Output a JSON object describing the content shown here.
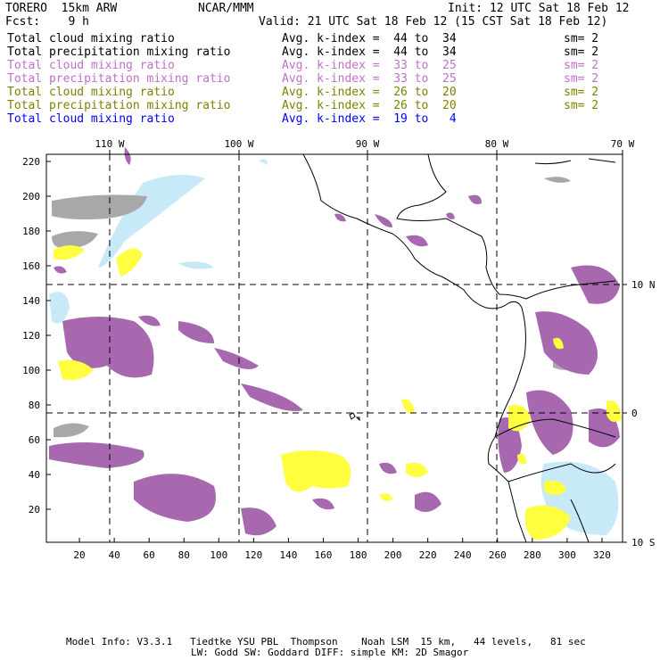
{
  "header": {
    "model": "TORERO  15km ARW",
    "org": "NCAR/MMM",
    "init": "Init: 12 UTC Sat 18 Feb 12",
    "fcst": "Fcst:    9 h",
    "valid": "Valid: 21 UTC Sat 18 Feb 12 (15 CST Sat 18 Feb 12)"
  },
  "legend": [
    {
      "field": "Total cloud mixing ratio",
      "kindex": "Avg. k-index =  44 to  34",
      "sm": "sm= 2",
      "color": "#000000"
    },
    {
      "field": "Total precipitation mixing ratio",
      "kindex": "Avg. k-index =  44 to  34",
      "sm": "sm= 2",
      "color": "#000000"
    },
    {
      "field": "Total cloud mixing ratio",
      "kindex": "Avg. k-index =  33 to  25",
      "sm": "sm= 2",
      "color": "#c070c8"
    },
    {
      "field": "Total precipitation mixing ratio",
      "kindex": "Avg. k-index =  33 to  25",
      "sm": "sm= 2",
      "color": "#c070c8"
    },
    {
      "field": "Total cloud mixing ratio",
      "kindex": "Avg. k-index =  26 to  20",
      "sm": "sm= 2",
      "color": "#808000"
    },
    {
      "field": "Total precipitation mixing ratio",
      "kindex": "Avg. k-index =  26 to  20",
      "sm": "sm= 2",
      "color": "#808000"
    },
    {
      "field": "Total cloud mixing ratio",
      "kindex": "Avg. k-index =  19 to   4",
      "sm": "",
      "color": "#0000ff"
    }
  ],
  "axes": {
    "x_ticks": [
      "20",
      "40",
      "60",
      "80",
      "100",
      "120",
      "140",
      "160",
      "180",
      "200",
      "220",
      "240",
      "260",
      "280",
      "300",
      "320"
    ],
    "y_ticks": [
      "20",
      "40",
      "60",
      "80",
      "100",
      "120",
      "140",
      "160",
      "180",
      "200",
      "220"
    ],
    "lon_labels": [
      "110 W",
      "100 W",
      "90 W",
      "80 W",
      "70 W"
    ],
    "lat_labels": [
      "10 N",
      "0",
      "10 S"
    ]
  },
  "footer": {
    "line1": "Model Info: V3.3.1   Tiedtke YSU PBL  Thompson    Noah LSM  15 km,   44 levels,   81 sec",
    "line2": "LW: Godd SW: Goddard DIFF: simple KM: 2D Smagor"
  },
  "colors": {
    "purple": "#a868b0",
    "yellow": "#ffff40",
    "gray": "#a8a8a8",
    "lightblue": "#c8eaf8"
  }
}
